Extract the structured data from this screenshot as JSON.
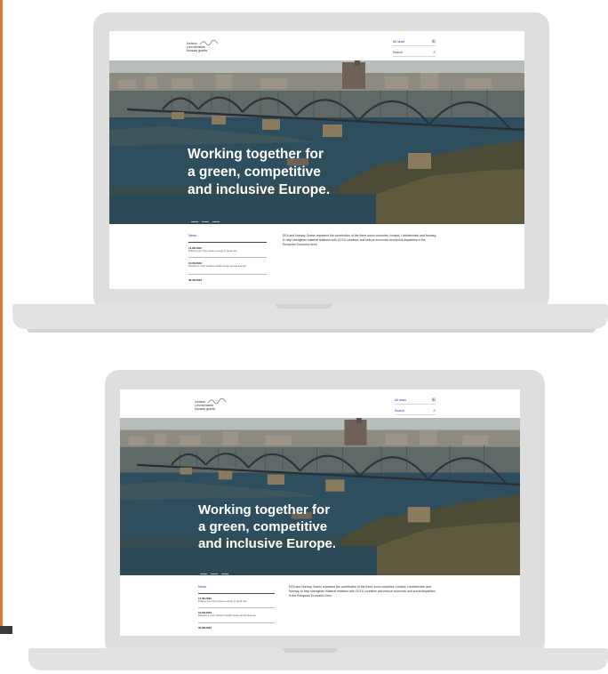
{
  "site": {
    "logo": {
      "line1": "Iceland",
      "line2": "Liechtenstein",
      "line3": "Norway grants",
      "mark_alt": "Norway grants"
    },
    "nav": [
      {
        "label": "All news",
        "icon": "grid-icon"
      },
      {
        "label": "Search",
        "icon": "search-icon"
      }
    ],
    "hero": {
      "title_line1": "Working together for",
      "title_line2": "a green, competitive",
      "title_line3": "and inclusive Europe."
    },
    "news": {
      "heading": "News",
      "items": [
        {
          "date": "11.08.2023",
          "headline": "Putting your city's green energy to good use"
        },
        {
          "date": "10.08.2023",
          "headline": "Rebuild a more resilient health sector across Europe"
        },
        {
          "date": "09.08.2023",
          "headline": ""
        }
      ]
    },
    "intro": "EEA and Norway Grants represent the contribution of the three donor countries, Iceland, Liechtenstein and Norway, to help strengthen bilateral relations with 15 EU countries and reduce economic and social disparities in the European Economic Area."
  },
  "colors": {
    "accent_bar": "#e07a2e",
    "laptop_body": "#dedede",
    "link": "#2d3a9a"
  }
}
